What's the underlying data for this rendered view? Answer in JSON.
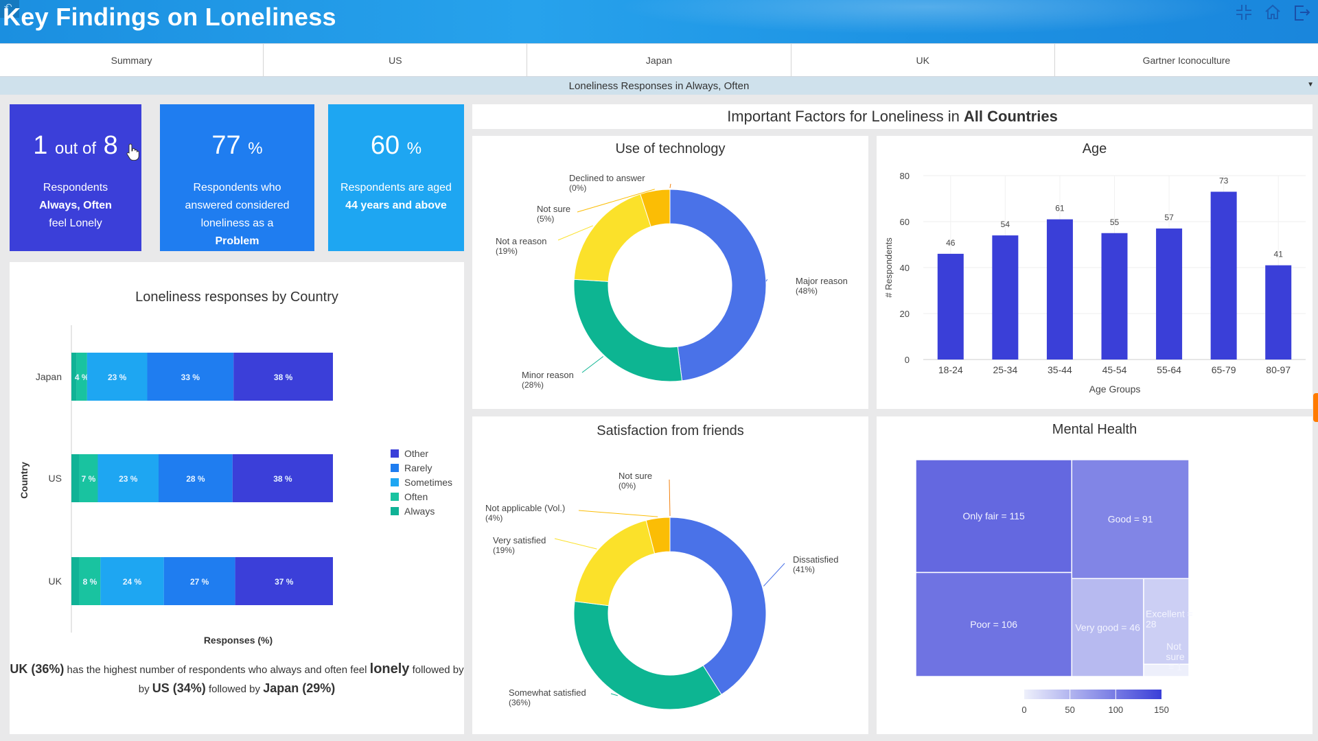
{
  "header": {
    "title": "Key Findings on Loneliness",
    "back_icon": "back-arrow-icon",
    "icons": [
      "collapse-icon",
      "home-icon",
      "exit-icon"
    ]
  },
  "tabs": [
    {
      "label": "Summary"
    },
    {
      "label": "US"
    },
    {
      "label": "Japan"
    },
    {
      "label": "UK"
    },
    {
      "label": "Gartner Iconoculture"
    }
  ],
  "filter": {
    "label": "Loneliness Responses in Always, Often"
  },
  "kpis": [
    {
      "big_num": "1",
      "big_mid": "out of",
      "big_end": "8",
      "line1": "Respondents",
      "line2": "Always, Often",
      "line3": "feel Lonely",
      "color": "#3b3fd9"
    },
    {
      "big_num": "77",
      "unit": "%",
      "line1": "Respondents who",
      "line2": "answered considered",
      "line3": "loneliness as a",
      "line4": "Problem",
      "color": "#1f7df0"
    },
    {
      "big_num": "60",
      "unit": "%",
      "line1": "Respondents are aged",
      "line2": "44 years and above",
      "color": "#1ea6f2"
    }
  ],
  "factors_header": {
    "prefix": "Important Factors for Loneliness in",
    "bold": "All Countries"
  },
  "caption": {
    "p1": "UK (36%)",
    "p2": "has the highest number of respondents who always and often feel",
    "p3": "lonely",
    "p4": "followed by",
    "p5": "US (34%)",
    "p6": "followed by",
    "p7": "Japan (29%)"
  },
  "chart_data": [
    {
      "type": "bar",
      "orientation": "horizontal-stacked",
      "title": "Loneliness responses by Country",
      "xlabel": "Responses (%)",
      "ylabel": "Country",
      "categories": [
        "Japan",
        "US",
        "UK"
      ],
      "series": [
        {
          "name": "Always",
          "color": "#10b296",
          "values": [
            2,
            3,
            3
          ]
        },
        {
          "name": "Often",
          "color": "#19c3a0",
          "values": [
            4,
            7,
            8
          ]
        },
        {
          "name": "Sometimes",
          "color": "#1ea6f2",
          "values": [
            23,
            23,
            24
          ]
        },
        {
          "name": "Rarely",
          "color": "#1f7df0",
          "values": [
            33,
            28,
            27
          ]
        },
        {
          "name": "Other",
          "color": "#3b3fd9",
          "values": [
            38,
            38,
            37
          ]
        }
      ],
      "labels": [
        [
          "",
          "4 %",
          "23 %",
          "33 %",
          "38 %"
        ],
        [
          "",
          "7 %",
          "23 %",
          "28 %",
          "38 %"
        ],
        [
          "",
          "8 %",
          "24 %",
          "27 %",
          "37 %"
        ]
      ],
      "legend_order": [
        "Other",
        "Rarely",
        "Sometimes",
        "Often",
        "Always"
      ],
      "legend": "right"
    },
    {
      "type": "pie",
      "donut": true,
      "title": "Use of technology",
      "slices": [
        {
          "label": "Major reason",
          "value": 48,
          "color": "#4a72e8"
        },
        {
          "label": "Minor reason",
          "value": 28,
          "color": "#0db592"
        },
        {
          "label": "Not a reason",
          "value": 19,
          "color": "#fbe12a"
        },
        {
          "label": "Not sure",
          "value": 5,
          "color": "#fbbd05"
        },
        {
          "label": "Declined to answer",
          "value": 0,
          "color": "#f27f0c"
        }
      ]
    },
    {
      "type": "bar",
      "title": "Age",
      "xlabel": "Age Groups",
      "ylabel": "# Respondents",
      "categories": [
        "18-24",
        "25-34",
        "35-44",
        "45-54",
        "55-64",
        "65-79",
        "80-97"
      ],
      "values": [
        46,
        54,
        61,
        55,
        57,
        73,
        41
      ],
      "ylim": [
        0,
        80
      ],
      "yticks": [
        0,
        20,
        40,
        60,
        80
      ],
      "color": "#3a3fd8",
      "grid": true
    },
    {
      "type": "pie",
      "donut": true,
      "title": "Satisfaction from friends",
      "slices": [
        {
          "label": "Dissatisfied",
          "value": 41,
          "color": "#4a72e8"
        },
        {
          "label": "Somewhat satisfied",
          "value": 36,
          "color": "#0db592"
        },
        {
          "label": "Very satisfied",
          "value": 19,
          "color": "#fbe12a"
        },
        {
          "label": "Not applicable (Vol.)",
          "value": 4,
          "color": "#fbbd05"
        },
        {
          "label": "Not sure",
          "value": 0,
          "color": "#f27f0c"
        }
      ]
    },
    {
      "type": "heatmap",
      "subtype": "treemap",
      "title": "Mental Health",
      "cells": [
        {
          "label": "Only fair",
          "value": 115
        },
        {
          "label": "Poor",
          "value": 106
        },
        {
          "label": "Good",
          "value": 91
        },
        {
          "label": "Very good",
          "value": 46
        },
        {
          "label": "Excellent",
          "value": 28
        },
        {
          "label": "Not sure",
          "value": 1
        }
      ],
      "colorscale": {
        "min": 0,
        "max": 150,
        "ticks": [
          0,
          50,
          100,
          150
        ],
        "from": "#eef0fb",
        "to": "#3a3fd8"
      }
    }
  ]
}
